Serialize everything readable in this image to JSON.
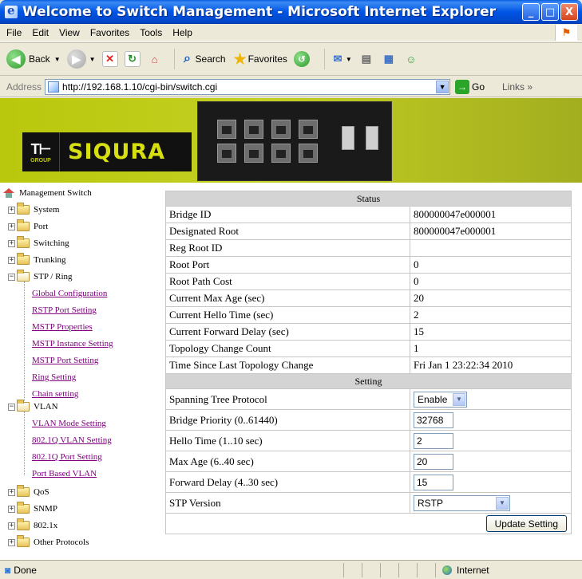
{
  "window": {
    "title": "Welcome to Switch Management - Microsoft Internet Explorer",
    "minimize": "_",
    "maximize": "□",
    "close": "X"
  },
  "menu": [
    "File",
    "Edit",
    "View",
    "Favorites",
    "Tools",
    "Help"
  ],
  "toolbar": {
    "back": "Back",
    "search": "Search",
    "favorites": "Favorites"
  },
  "address": {
    "label": "Address",
    "url": "http://192.168.1.10/cgi-bin/switch.cgi",
    "go": "Go",
    "links": "Links"
  },
  "banner": {
    "logo_group": "GROUP",
    "logo_th": "T⊢",
    "logo_brand": "SIQURA"
  },
  "sidebar": {
    "root": "Management Switch",
    "folders": [
      "System",
      "Port",
      "Switching",
      "Trunking"
    ],
    "stp": {
      "label": "STP / Ring",
      "items": [
        "Global Configuration",
        "RSTP Port Setting",
        "MSTP Properties",
        "MSTP Instance Setting",
        "MSTP Port Setting",
        "Ring Setting",
        "Chain setting"
      ]
    },
    "vlan": {
      "label": "VLAN",
      "items": [
        "VLAN Mode Setting",
        "802.1Q VLAN Setting",
        "802.1Q Port Setting",
        "Port Based VLAN"
      ]
    },
    "bottom_folders": [
      "QoS",
      "SNMP",
      "802.1x",
      "Other Protocols"
    ]
  },
  "status": {
    "header": "Status",
    "rows": [
      {
        "label": "Bridge ID",
        "value": "800000047e000001"
      },
      {
        "label": "Designated Root",
        "value": "800000047e000001"
      },
      {
        "label": "Reg Root ID",
        "value": ""
      },
      {
        "label": "Root Port",
        "value": "0"
      },
      {
        "label": "Root Path Cost",
        "value": "0"
      },
      {
        "label": "Current Max Age (sec)",
        "value": "20"
      },
      {
        "label": "Current Hello Time (sec)",
        "value": "2"
      },
      {
        "label": "Current Forward Delay (sec)",
        "value": "15"
      },
      {
        "label": "Topology Change Count",
        "value": "1"
      },
      {
        "label": "Time Since Last Topology Change",
        "value": "Fri Jan 1 23:22:34 2010"
      }
    ]
  },
  "setting": {
    "header": "Setting",
    "stp_label": "Spanning Tree Protocol",
    "stp_value": "Enable",
    "priority_label": "Bridge Priority (0..61440)",
    "priority_value": "32768",
    "hello_label": "Hello Time (1..10 sec)",
    "hello_value": "2",
    "maxage_label": "Max Age (6..40 sec)",
    "maxage_value": "20",
    "fwd_label": "Forward Delay (4..30 sec)",
    "fwd_value": "15",
    "version_label": "STP Version",
    "version_value": "RSTP",
    "update_button": "Update Setting"
  },
  "statusbar": {
    "left": "Done",
    "zone": "Internet"
  }
}
